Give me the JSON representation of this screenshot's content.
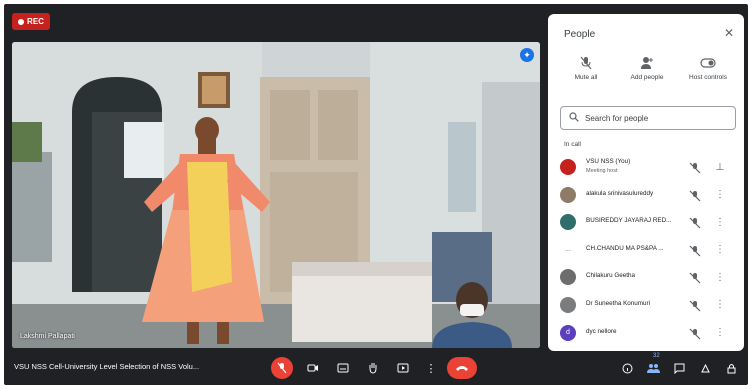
{
  "recording": {
    "label": "REC"
  },
  "video": {
    "participant_name": "Lakshmi Pallapati"
  },
  "panel": {
    "title": "People",
    "actions": [
      {
        "label": "Mute all",
        "icon": "mic-off-icon"
      },
      {
        "label": "Add people",
        "icon": "add-person-icon"
      },
      {
        "label": "Host controls",
        "icon": "toggle-icon"
      }
    ],
    "search_placeholder": "Search for people",
    "section_label": "In call",
    "participants": [
      {
        "name": "VSU NSS (You)",
        "subtitle": "Meeting host",
        "avatar_color": "#c5221f",
        "avatar_text": ""
      },
      {
        "name": "alakula srinivasulureddy",
        "subtitle": "",
        "avatar_color": "#8d7b68",
        "avatar_text": ""
      },
      {
        "name": "BUSIREDDY JAYARAJ RED...",
        "subtitle": "",
        "avatar_color": "#2f6e6a",
        "avatar_text": ""
      },
      {
        "name": "CH.CHANDU MA PS&PA ...",
        "subtitle": "",
        "avatar_color": "#ffffff",
        "avatar_text": "..."
      },
      {
        "name": "Chilakuru Geetha",
        "subtitle": "",
        "avatar_color": "#6d6d6d",
        "avatar_text": ""
      },
      {
        "name": "Dr Suneetha Konumuri",
        "subtitle": "",
        "avatar_color": "#7a7c7e",
        "avatar_text": ""
      },
      {
        "name": "dyc nellore",
        "subtitle": "",
        "avatar_color": "#5b3fbd",
        "avatar_text": "d"
      }
    ]
  },
  "bottom": {
    "meeting_title": "VSU NSS Cell-University Level Selection of NSS Volu...",
    "people_count": "32"
  },
  "colors": {
    "accent": "#1a73e8",
    "danger": "#ea4335",
    "dark": "#202124"
  }
}
